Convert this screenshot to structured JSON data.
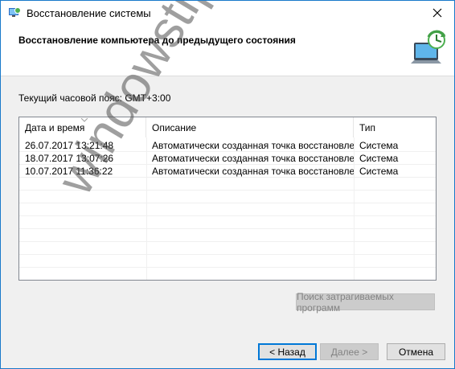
{
  "window": {
    "title": "Восстановление системы"
  },
  "header": {
    "title": "Восстановление компьютера до предыдущего состояния"
  },
  "timezone": {
    "label": "Текущий часовой пояс: GMT+3:00"
  },
  "table": {
    "columns": [
      "Дата и время",
      "Описание",
      "Тип"
    ],
    "rows": [
      [
        "26.07.2017 13:21:48",
        "Автоматически созданная точка восстановле...",
        "Система"
      ],
      [
        "18.07.2017 13:07:26",
        "Автоматически созданная точка восстановле...",
        "Система"
      ],
      [
        "10.07.2017 11:36:22",
        "Автоматически созданная точка восстановле...",
        "Система"
      ]
    ]
  },
  "buttons": {
    "scan": "Поиск затрагиваемых программ",
    "back": "< Назад",
    "next": "Далее >",
    "cancel": "Отмена"
  },
  "watermark": "windowstips.ru",
  "colors": {
    "accent": "#0078d7",
    "border": "#1979ca"
  }
}
